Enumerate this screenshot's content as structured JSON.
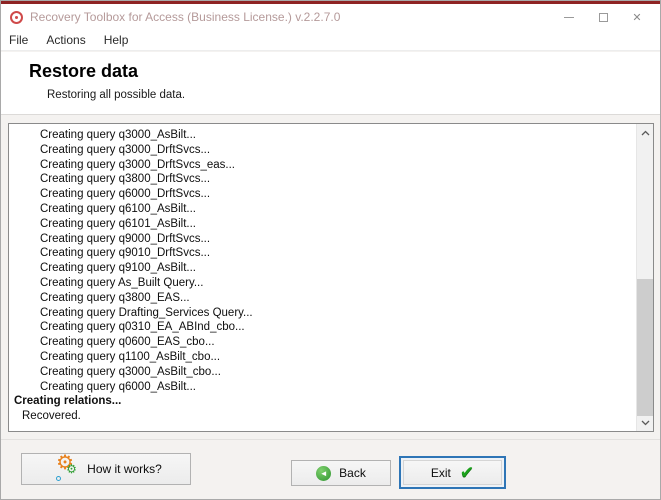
{
  "window": {
    "title": "Recovery Toolbox for Access (Business License.) v.2.2.7.0"
  },
  "menu": {
    "items": [
      "File",
      "Actions",
      "Help"
    ]
  },
  "header": {
    "title": "Restore data",
    "subtitle": "Restoring all possible data."
  },
  "log": {
    "lines": [
      {
        "text": "Creating query q3000_AsBilt...",
        "style": "indent"
      },
      {
        "text": "Creating query q3000_DrftSvcs...",
        "style": "indent"
      },
      {
        "text": "Creating query q3000_DrftSvcs_eas...",
        "style": "indent"
      },
      {
        "text": "Creating query q3800_DrftSvcs...",
        "style": "indent"
      },
      {
        "text": "Creating query q6000_DrftSvcs...",
        "style": "indent"
      },
      {
        "text": "Creating query q6100_AsBilt...",
        "style": "indent"
      },
      {
        "text": "Creating query q6101_AsBilt...",
        "style": "indent"
      },
      {
        "text": "Creating query q9000_DrftSvcs...",
        "style": "indent"
      },
      {
        "text": "Creating query q9010_DrftSvcs...",
        "style": "indent"
      },
      {
        "text": "Creating query q9100_AsBilt...",
        "style": "indent"
      },
      {
        "text": "Creating query As_Built Query...",
        "style": "indent"
      },
      {
        "text": "Creating query q3800_EAS...",
        "style": "indent"
      },
      {
        "text": "Creating query Drafting_Services Query...",
        "style": "indent"
      },
      {
        "text": "Creating query q0310_EA_ABInd_cbo...",
        "style": "indent"
      },
      {
        "text": "Creating query q0600_EAS_cbo...",
        "style": "indent"
      },
      {
        "text": "Creating query q1100_AsBilt_cbo...",
        "style": "indent"
      },
      {
        "text": "Creating query q3000_AsBilt_cbo...",
        "style": "indent"
      },
      {
        "text": "Creating query q6000_AsBilt...",
        "style": "indent"
      },
      {
        "text": "Creating relations...",
        "style": "bold"
      },
      {
        "text": "Recovered.",
        "style": "result"
      }
    ]
  },
  "footer": {
    "how_button": "How it works?",
    "back_button": "Back",
    "exit_button": "Exit"
  },
  "colors": {
    "accent_red": "#8e2323",
    "focus_blue": "#2e75b6",
    "gear_orange": "#e8821e",
    "gear_green": "#2f9e33",
    "back_green": "#2f9430",
    "check_green": "#1ca21c"
  }
}
